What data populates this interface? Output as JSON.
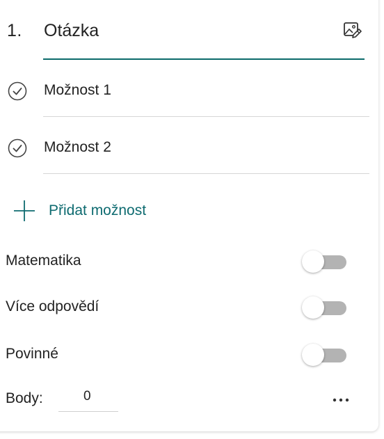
{
  "question": {
    "number": "1.",
    "title": "Otázka",
    "image_button_icon": "image-edit-icon"
  },
  "options": [
    {
      "label": "Možnost 1",
      "icon": "check-circle-icon"
    },
    {
      "label": "Možnost 2",
      "icon": "check-circle-icon"
    }
  ],
  "add_option": {
    "label": "Přidat možnost",
    "icon": "plus-icon"
  },
  "settings": [
    {
      "label": "Matematika",
      "on": false
    },
    {
      "label": "Více odpovědí",
      "on": false
    },
    {
      "label": "Povinné",
      "on": false
    }
  ],
  "points": {
    "label": "Body:",
    "value": "0"
  },
  "more_icon": "more-horizontal-icon",
  "colors": {
    "accent": "#0e6b70",
    "underline": "#0b6a6a",
    "toggle_off": "#b3b3b3"
  }
}
